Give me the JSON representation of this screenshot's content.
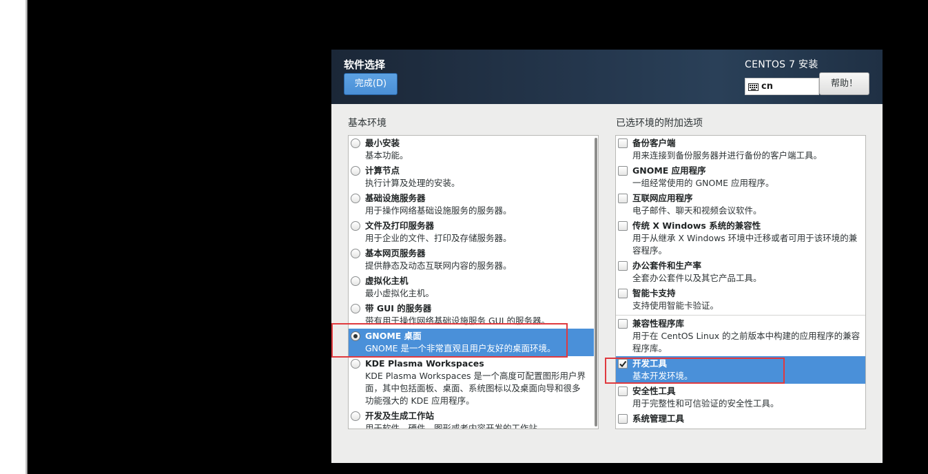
{
  "header": {
    "title": "软件选择",
    "done_button": "完成(D)",
    "product_title": "CENTOS 7 安装",
    "keyboard_icon": "keyboard-icon",
    "keyboard_layout": "cn",
    "help_button": "帮助！"
  },
  "base_env": {
    "label": "基本环境",
    "items": [
      {
        "name": "最小安装",
        "desc": [
          "基本功能。"
        ],
        "selected": false
      },
      {
        "name": "计算节点",
        "desc": [
          "执行计算及处理的安装。"
        ],
        "selected": false
      },
      {
        "name": "基础设施服务器",
        "desc": [
          "用于操作网络基础设施服务的服务器。"
        ],
        "selected": false
      },
      {
        "name": "文件及打印服务器",
        "desc": [
          "用于企业的文件、打印及存储服务器。"
        ],
        "selected": false
      },
      {
        "name": "基本网页服务器",
        "desc": [
          "提供静态及动态互联网内容的服务器。"
        ],
        "selected": false
      },
      {
        "name": "虚拟化主机",
        "desc": [
          "最小虚拟化主机。"
        ],
        "selected": false
      },
      {
        "name": "带 GUI 的服务器",
        "desc": [
          "带有用于操作网络基础设施服务 GUI 的服务器。"
        ],
        "selected": false
      },
      {
        "name": "GNOME 桌面",
        "desc": [
          "GNOME 是一个非常直观且用户友好的桌面环境。"
        ],
        "selected": true
      },
      {
        "name": "KDE Plasma Workspaces",
        "desc": [
          "KDE Plasma Workspaces 是一个高度可配置图形用户界",
          "面，其中包括面板、桌面、系统图标以及桌面向导和很多",
          "功能强大的 KDE 应用程序。"
        ],
        "selected": false
      },
      {
        "name": "开发及生成工作站",
        "desc": [
          "用于软件、硬件、图形或者内容开发的工作站。"
        ],
        "selected": false
      }
    ]
  },
  "addons": {
    "label": "已选环境的附加选项",
    "items": [
      {
        "name": "备份客户端",
        "desc": [
          "用来连接到备份服务器并进行备份的客户端工具。"
        ],
        "checked": false
      },
      {
        "name": "GNOME 应用程序",
        "desc": [
          "一组经常使用的 GNOME 应用程序。"
        ],
        "checked": false
      },
      {
        "name": "互联网应用程序",
        "desc": [
          "电子邮件、聊天和视频会议软件。"
        ],
        "checked": false
      },
      {
        "name": "传统 X Windows 系统的兼容性",
        "desc": [
          "用于从继承 X Windows 环境中迁移或者可用于该环境的兼",
          "容程序。"
        ],
        "checked": false
      },
      {
        "name": "办公套件和生产率",
        "desc": [
          "全套办公套件以及其它产品工具。"
        ],
        "checked": false
      },
      {
        "name": "智能卡支持",
        "desc": [
          "支持使用智能卡验证。"
        ],
        "checked": false
      },
      {
        "name": "兼容性程序库",
        "desc": [
          "用于在 CentOS Linux 的之前版本中构建的应用程序的兼容",
          "程序库。"
        ],
        "checked": false
      },
      {
        "name": "开发工具",
        "desc": [
          "基本开发环境。"
        ],
        "checked": true,
        "selected": true
      },
      {
        "name": "安全性工具",
        "desc": [
          "用于完整性和可信验证的安全性工具。"
        ],
        "checked": false
      },
      {
        "name": "系统管理工具",
        "desc": [],
        "checked": false
      }
    ]
  },
  "colors": {
    "selection": "#4a90d9",
    "annotation": "#e0393e",
    "done_button": "#4a8fd6"
  }
}
